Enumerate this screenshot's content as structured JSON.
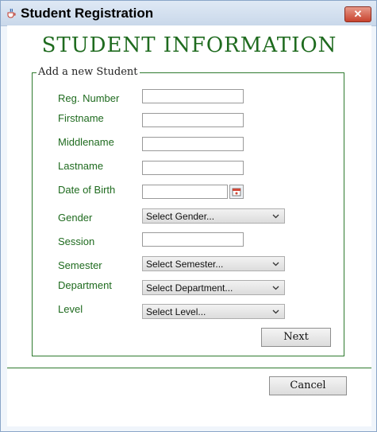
{
  "window": {
    "title": "Student Registration",
    "close_glyph": "✕"
  },
  "heading": "STUDENT INFORMATION",
  "group": {
    "legend": "Add a new Student"
  },
  "fields": {
    "reg_number": {
      "label": "Reg. Number",
      "value": ""
    },
    "firstname": {
      "label": "Firstname",
      "value": ""
    },
    "middlename": {
      "label": "Middlename",
      "value": ""
    },
    "lastname": {
      "label": "Lastname",
      "value": ""
    },
    "date_of_birth": {
      "label": "Date of Birth",
      "value": ""
    },
    "gender": {
      "label": "Gender",
      "selected": "Select Gender..."
    },
    "session": {
      "label": "Session",
      "value": ""
    },
    "semester": {
      "label": "Semester",
      "selected": "Select Semester..."
    },
    "department": {
      "label": "Department",
      "selected": "Select Department..."
    },
    "level": {
      "label": "Level",
      "selected": "Select Level..."
    }
  },
  "buttons": {
    "next": "Next",
    "cancel": "Cancel"
  },
  "icons": {
    "app": "java-cup-icon",
    "close": "close-icon",
    "calendar": "calendar-icon",
    "dropdown": "chevron-down-icon"
  },
  "colors": {
    "accent_green": "#1f6b1f",
    "border_green": "#2f7a2f",
    "close_red": "#c8432e"
  }
}
